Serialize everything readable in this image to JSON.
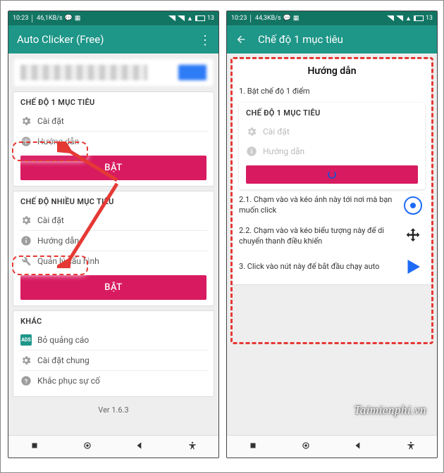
{
  "statusbar": {
    "time": "10:23",
    "net_left": "46,1KB/s",
    "net_right": "44,3KB/s",
    "battery": "13"
  },
  "left": {
    "title": "Auto Clicker (Free)",
    "section1": {
      "title": "CHẾ ĐỘ 1 MỤC TIÊU",
      "settings": "Cài đặt",
      "guide": "Hướng dẫn",
      "enable": "BẬT"
    },
    "section2": {
      "title": "CHẾ ĐỘ NHIỀU MỤC TIÊU",
      "settings": "Cài đặt",
      "guide": "Hướng dẫn",
      "config": "Quản lý cấu hình",
      "enable": "BẬT"
    },
    "other": {
      "title": "KHÁC",
      "ads": "Bỏ quảng cáo",
      "ads_ic": "ADS",
      "general": "Cài đặt chung",
      "troubleshoot": "Khắc phục sự cố"
    },
    "version": "Ver 1.6.3"
  },
  "right": {
    "title": "Chế độ 1 mục tiêu",
    "guide_title": "Hướng dẫn",
    "step1": "1. Bật chế độ 1 điểm",
    "embed": {
      "title": "CHẾ ĐỘ 1 MỤC TIÊU",
      "settings": "Cài đặt",
      "guide": "Hướng dẫn"
    },
    "step21": "2.1. Chạm vào và kéo ảnh này tới nơi mà bạn muốn click",
    "step22": "2.2. Chạm vào và kéo biểu tượng này để di chuyển thanh điều khiển",
    "step3": "3. Click vào nút này để bắt đầu chạy auto"
  },
  "watermark": "Taimienphi.vn"
}
